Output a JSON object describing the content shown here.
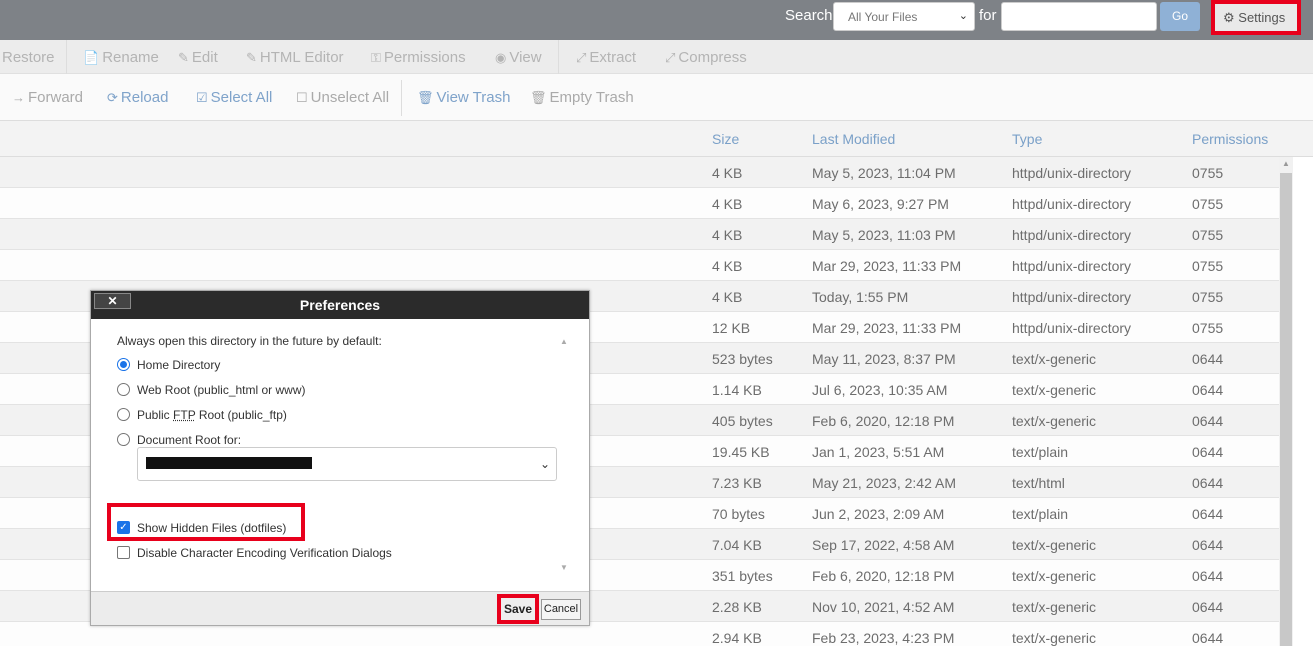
{
  "search": {
    "label": "Search",
    "scope_value": "All Your Files",
    "for_label": "for",
    "input_value": "",
    "go_label": "Go",
    "settings_label": "Settings"
  },
  "toolbar1": {
    "restore": "Restore",
    "rename": "Rename",
    "edit": "Edit",
    "html_editor": "HTML Editor",
    "permissions": "Permissions",
    "view": "View",
    "extract": "Extract",
    "compress": "Compress"
  },
  "toolbar2": {
    "forward": "Forward",
    "reload": "Reload",
    "select_all": "Select All",
    "unselect_all": "Unselect All",
    "view_trash": "View Trash",
    "empty_trash": "Empty Trash"
  },
  "table": {
    "headers": {
      "size": "Size",
      "modified": "Last Modified",
      "type": "Type",
      "perms": "Permissions"
    },
    "rows": [
      {
        "size": "4 KB",
        "modified": "May 5, 2023, 11:04 PM",
        "type": "httpd/unix-directory",
        "perms": "0755"
      },
      {
        "size": "4 KB",
        "modified": "May 6, 2023, 9:27 PM",
        "type": "httpd/unix-directory",
        "perms": "0755"
      },
      {
        "size": "4 KB",
        "modified": "May 5, 2023, 11:03 PM",
        "type": "httpd/unix-directory",
        "perms": "0755"
      },
      {
        "size": "4 KB",
        "modified": "Mar 29, 2023, 11:33 PM",
        "type": "httpd/unix-directory",
        "perms": "0755"
      },
      {
        "size": "4 KB",
        "modified": "Today, 1:55 PM",
        "type": "httpd/unix-directory",
        "perms": "0755"
      },
      {
        "size": "12 KB",
        "modified": "Mar 29, 2023, 11:33 PM",
        "type": "httpd/unix-directory",
        "perms": "0755"
      },
      {
        "size": "523 bytes",
        "modified": "May 11, 2023, 8:37 PM",
        "type": "text/x-generic",
        "perms": "0644"
      },
      {
        "size": "1.14 KB",
        "modified": "Jul 6, 2023, 10:35 AM",
        "type": "text/x-generic",
        "perms": "0644"
      },
      {
        "size": "405 bytes",
        "modified": "Feb 6, 2020, 12:18 PM",
        "type": "text/x-generic",
        "perms": "0644"
      },
      {
        "size": "19.45 KB",
        "modified": "Jan 1, 2023, 5:51 AM",
        "type": "text/plain",
        "perms": "0644"
      },
      {
        "size": "7.23 KB",
        "modified": "May 21, 2023, 2:42 AM",
        "type": "text/html",
        "perms": "0644"
      },
      {
        "size": "70 bytes",
        "modified": "Jun 2, 2023, 2:09 AM",
        "type": "text/plain",
        "perms": "0644"
      },
      {
        "size": "7.04 KB",
        "modified": "Sep 17, 2022, 4:58 AM",
        "type": "text/x-generic",
        "perms": "0644"
      },
      {
        "size": "351 bytes",
        "modified": "Feb 6, 2020, 12:18 PM",
        "type": "text/x-generic",
        "perms": "0644"
      },
      {
        "size": "2.28 KB",
        "modified": "Nov 10, 2021, 4:52 AM",
        "type": "text/x-generic",
        "perms": "0644"
      },
      {
        "size": "2.94 KB",
        "modified": "Feb 23, 2023, 4:23 PM",
        "type": "text/x-generic",
        "perms": "0644"
      }
    ]
  },
  "preferences": {
    "title": "Preferences",
    "close_label": "✕",
    "intro": "Always open this directory in the future by default:",
    "home_dir": "Home Directory",
    "web_root": "Web Root (public_html or www)",
    "ftp_root_pre": "Public ",
    "ftp_root_abbr": "FTP",
    "ftp_root_post": " Root (public_ftp)",
    "doc_root": "Document Root for:",
    "show_hidden": "Show Hidden Files (dotfiles)",
    "disable_encoding": "Disable Character Encoding Verification Dialogs",
    "save_label": "Save",
    "cancel_label": "Cancel",
    "selected_option": "Home Directory",
    "show_hidden_checked": true,
    "disable_encoding_checked": false
  }
}
